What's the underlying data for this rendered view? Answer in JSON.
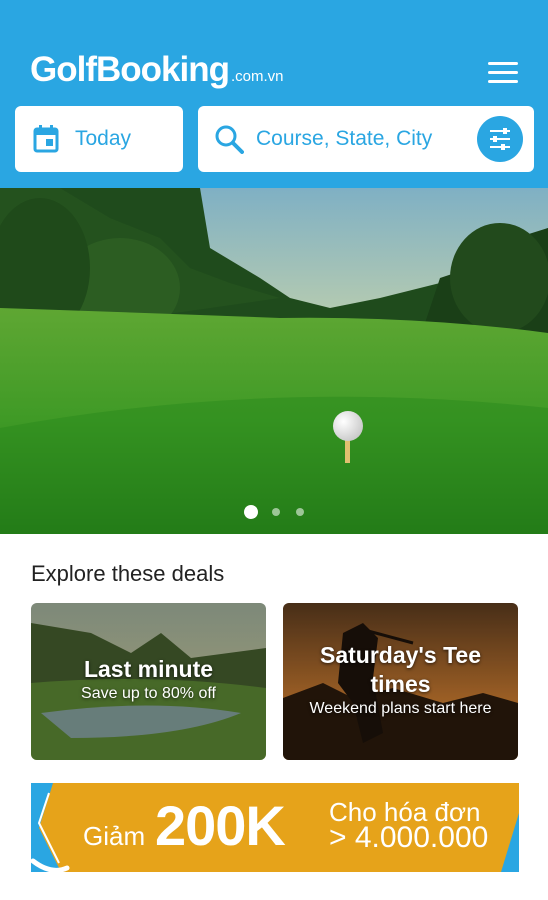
{
  "app": {
    "logo_main": "GolfBooking",
    "logo_tld": ".com.vn",
    "menu_icon": "hamburger-menu-icon"
  },
  "search_bar": {
    "date_label": "Today",
    "date_icon": "calendar-icon",
    "search_placeholder": "Course, State, City",
    "search_icon": "search-icon",
    "filter_icon": "filter-sliders-icon"
  },
  "hero": {
    "slide_count": 3,
    "active_slide": 1
  },
  "deals": {
    "section_title": "Explore these deals",
    "items": [
      {
        "title": "Last minute",
        "subtitle": "Save up to 80% off"
      },
      {
        "title": "Saturday's Tee times",
        "title_line1": "Saturday's Tee",
        "title_line2": "times",
        "subtitle": "Weekend plans start here"
      }
    ]
  },
  "promo": {
    "label": "Giảm",
    "amount": "200K",
    "condition_line1": "Cho hóa đơn",
    "condition_line2": "> 4.000.000"
  },
  "colors": {
    "primary": "#2aa6e2",
    "promo": "#e6a31a",
    "white": "#ffffff",
    "text": "#222222"
  }
}
